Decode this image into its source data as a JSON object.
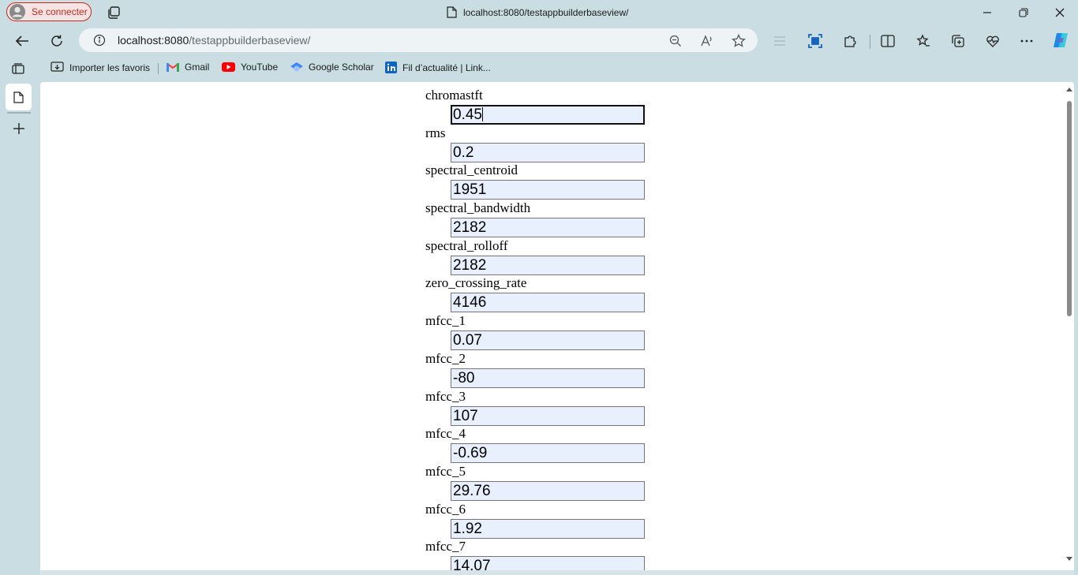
{
  "browser": {
    "profile_label": "Se connecter",
    "tab_title": "localhost:8080/testappbuilderbaseview/",
    "url_host": "localhost:8080",
    "url_path": "/testappbuilderbaseview/"
  },
  "favorites": [
    {
      "label": "Importer les favoris",
      "icon": "import-favorites-icon"
    },
    {
      "label": "Gmail",
      "icon": "gmail-icon"
    },
    {
      "label": "YouTube",
      "icon": "youtube-icon"
    },
    {
      "label": "Google Scholar",
      "icon": "google-scholar-icon"
    },
    {
      "label": "Fil d’actualité | Link...",
      "icon": "linkedin-icon"
    }
  ],
  "form": {
    "fields": [
      {
        "label": "chromastft",
        "value": "0.45"
      },
      {
        "label": "rms",
        "value": "0.2"
      },
      {
        "label": "spectral_centroid",
        "value": "1951"
      },
      {
        "label": "spectral_bandwidth",
        "value": "2182"
      },
      {
        "label": "spectral_rolloff",
        "value": "2182"
      },
      {
        "label": "zero_crossing_rate",
        "value": "4146"
      },
      {
        "label": "mfcc_1",
        "value": "0.07"
      },
      {
        "label": "mfcc_2",
        "value": "-80"
      },
      {
        "label": "mfcc_3",
        "value": "107"
      },
      {
        "label": "mfcc_4",
        "value": "-0.69"
      },
      {
        "label": "mfcc_5",
        "value": "29.76"
      },
      {
        "label": "mfcc_6",
        "value": "1.92"
      },
      {
        "label": "mfcc_7",
        "value": "14.07"
      }
    ]
  },
  "colors": {
    "chrome_bg": "#c9dde3",
    "input_bg": "#e8f0fe",
    "profile_accent": "#c42b1c"
  }
}
